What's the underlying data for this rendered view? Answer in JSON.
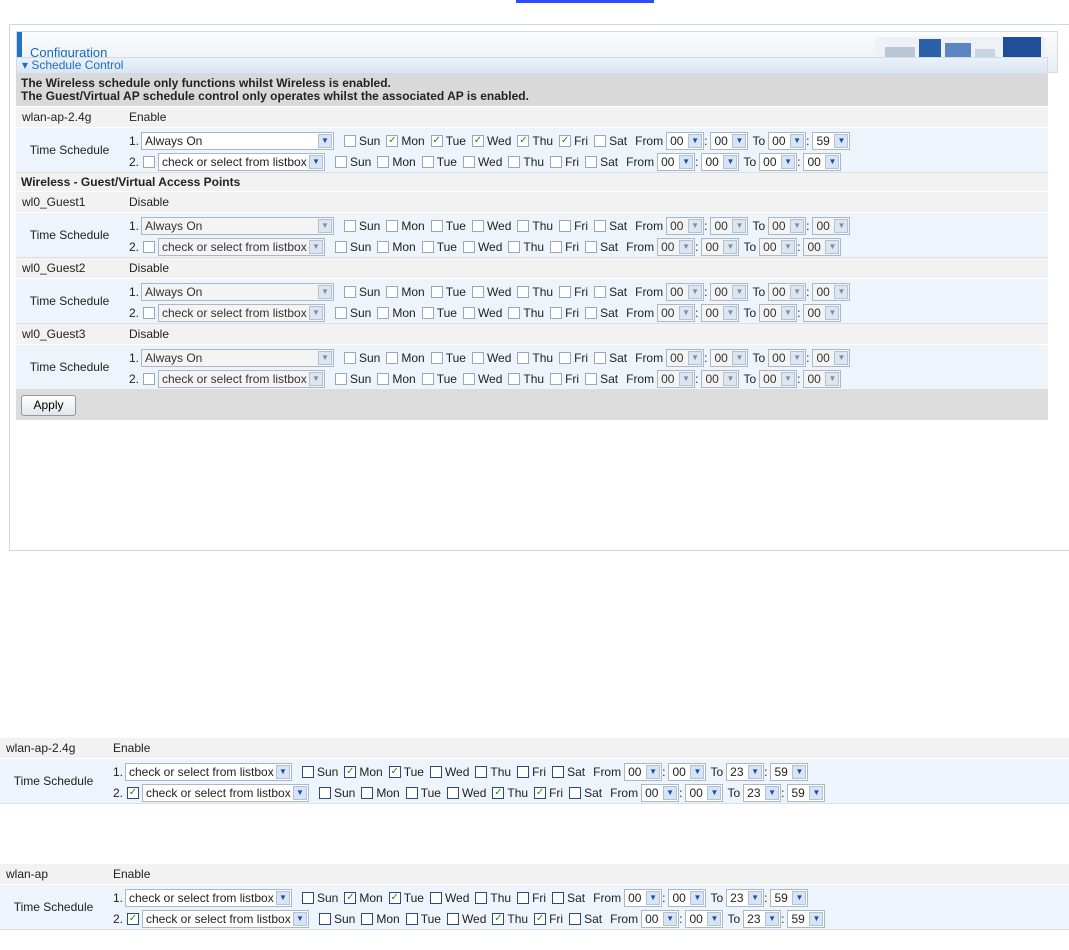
{
  "config_title": "Configuration",
  "section_title": "Schedule Control",
  "notice1": "The Wireless schedule only functions whilst Wireless is enabled.",
  "notice2": "The Guest/Virtual AP schedule control only operates whilst the associated AP is enabled.",
  "guest_heading": "Wireless - Guest/Virtual Access Points",
  "apply_label": "Apply",
  "ts_label": "Time Schedule",
  "from": "From",
  "to": "To",
  "days": [
    "Sun",
    "Mon",
    "Tue",
    "Wed",
    "Thu",
    "Fri",
    "Sat"
  ],
  "top": [
    {
      "name": "wlan-ap-2.4g",
      "status": "Enable",
      "l1": {
        "num": "1.",
        "sel": "Always On",
        "checked": [
          false,
          true,
          true,
          true,
          true,
          true,
          false
        ],
        "fh": "00",
        "fm": "00",
        "th": "00",
        "tm": "59"
      },
      "l2": {
        "num": "2.",
        "sel": "check or select from listbox",
        "checkbox": false,
        "checked": [
          false,
          false,
          false,
          false,
          false,
          false,
          false
        ],
        "fh": "00",
        "fm": "00",
        "th": "00",
        "tm": "00"
      }
    },
    {
      "name": "wl0_Guest1",
      "status": "Disable",
      "l1": {
        "num": "1.",
        "sel": "Always On",
        "checked": [
          false,
          false,
          false,
          false,
          false,
          false,
          false
        ],
        "fh": "00",
        "fm": "00",
        "th": "00",
        "tm": "00"
      },
      "l2": {
        "num": "2.",
        "sel": "check or select from listbox",
        "checkbox": false,
        "checked": [
          false,
          false,
          false,
          false,
          false,
          false,
          false
        ],
        "fh": "00",
        "fm": "00",
        "th": "00",
        "tm": "00"
      }
    },
    {
      "name": "wl0_Guest2",
      "status": "Disable",
      "l1": {
        "num": "1.",
        "sel": "Always On",
        "checked": [
          false,
          false,
          false,
          false,
          false,
          false,
          false
        ],
        "fh": "00",
        "fm": "00",
        "th": "00",
        "tm": "00"
      },
      "l2": {
        "num": "2.",
        "sel": "check or select from listbox",
        "checkbox": false,
        "checked": [
          false,
          false,
          false,
          false,
          false,
          false,
          false
        ],
        "fh": "00",
        "fm": "00",
        "th": "00",
        "tm": "00"
      }
    },
    {
      "name": "wl0_Guest3",
      "status": "Disable",
      "l1": {
        "num": "1.",
        "sel": "Always On",
        "checked": [
          false,
          false,
          false,
          false,
          false,
          false,
          false
        ],
        "fh": "00",
        "fm": "00",
        "th": "00",
        "tm": "00"
      },
      "l2": {
        "num": "2.",
        "sel": "check or select from listbox",
        "checkbox": false,
        "checked": [
          false,
          false,
          false,
          false,
          false,
          false,
          false
        ],
        "fh": "00",
        "fm": "00",
        "th": "00",
        "tm": "00"
      }
    }
  ],
  "bottom": [
    {
      "name": "wlan-ap-2.4g",
      "status": "Enable",
      "l1": {
        "num": "1.",
        "sel": "check or select from listbox",
        "checked": [
          false,
          true,
          true,
          false,
          false,
          false,
          false
        ],
        "fh": "00",
        "fm": "00",
        "th": "23",
        "tm": "59"
      },
      "l2": {
        "num": "2.",
        "sel": "check or select from listbox",
        "checkbox": true,
        "checked": [
          false,
          false,
          false,
          false,
          true,
          true,
          false
        ],
        "fh": "00",
        "fm": "00",
        "th": "23",
        "tm": "59"
      }
    },
    {
      "name": "wlan-ap",
      "status": "Enable",
      "l1": {
        "num": "1.",
        "sel": "check or select from listbox",
        "checked": [
          false,
          true,
          true,
          false,
          false,
          false,
          false
        ],
        "fh": "00",
        "fm": "00",
        "th": "23",
        "tm": "59"
      },
      "l2": {
        "num": "2.",
        "sel": "check or select from listbox",
        "checkbox": true,
        "checked": [
          false,
          false,
          false,
          false,
          true,
          true,
          false
        ],
        "fh": "00",
        "fm": "00",
        "th": "23",
        "tm": "59"
      }
    }
  ]
}
